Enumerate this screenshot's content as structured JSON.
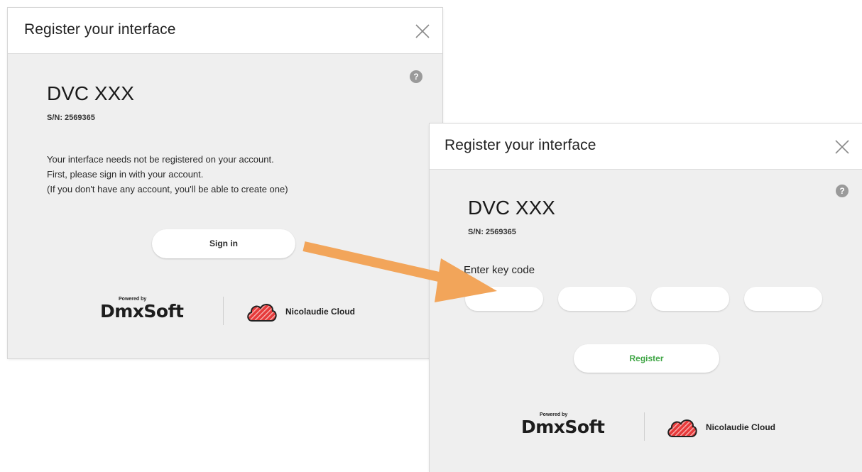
{
  "dialog_1": {
    "title": "Register your interface",
    "device_name": "DVC XXX",
    "serial": "S/N: 2569365",
    "message_lines": [
      "Your interface needs not be registered on your account.",
      "First, please sign in with your account.",
      "(If you don't have any account, you'll be able to create one)"
    ],
    "signin_label": "Sign in",
    "powered_by": "Powered by",
    "dmx_logo": "DmxSoft",
    "cloud_label": "Nicolaudie Cloud",
    "help_label": "?"
  },
  "dialog_2": {
    "title": "Register your interface",
    "device_name": "DVC XXX",
    "serial": "S/N: 2569365",
    "keycode_label": "Enter key code",
    "key_fields": [
      "",
      "",
      "",
      ""
    ],
    "register_label": "Register",
    "powered_by": "Powered by",
    "dmx_logo": "DmxSoft",
    "cloud_label": "Nicolaudie Cloud",
    "help_label": "?"
  },
  "icons": {
    "close": "close-icon",
    "help": "help-icon",
    "cloud": "nicolaudie-cloud-icon",
    "arrow": "arrow-icon"
  },
  "colors": {
    "arrow": "#f2a55a",
    "register_text": "#3ea544",
    "cloud_red": "#e63a3a",
    "dialog_bg": "#efefef"
  }
}
